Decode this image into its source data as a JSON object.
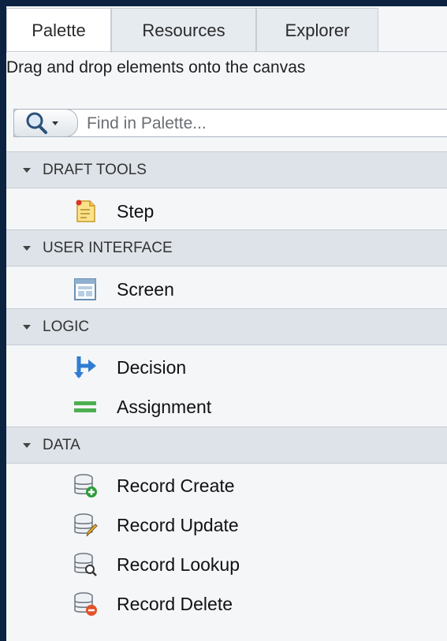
{
  "tabs": [
    {
      "label": "Palette",
      "active": true
    },
    {
      "label": "Resources",
      "active": false
    },
    {
      "label": "Explorer",
      "active": false
    }
  ],
  "hint": "Drag and drop elements onto the canvas",
  "search": {
    "placeholder": "Find in Palette..."
  },
  "sections": [
    {
      "title": "DRAFT TOOLS",
      "items": [
        {
          "label": "Step",
          "icon": "step-note-icon"
        }
      ]
    },
    {
      "title": "USER INTERFACE",
      "items": [
        {
          "label": "Screen",
          "icon": "screen-icon"
        }
      ]
    },
    {
      "title": "LOGIC",
      "items": [
        {
          "label": "Decision",
          "icon": "decision-arrow-icon"
        },
        {
          "label": "Assignment",
          "icon": "assignment-equals-icon"
        }
      ]
    },
    {
      "title": "DATA",
      "items": [
        {
          "label": "Record Create",
          "icon": "record-create-icon"
        },
        {
          "label": "Record Update",
          "icon": "record-update-icon"
        },
        {
          "label": "Record Lookup",
          "icon": "record-lookup-icon"
        },
        {
          "label": "Record Delete",
          "icon": "record-delete-icon"
        }
      ]
    }
  ],
  "colors": {
    "page_bg": "#0b2340",
    "panel_bg": "#f4f6f8",
    "section_bg": "#dde3e8",
    "record_create": "#2e9d3a",
    "record_delete": "#e2522a",
    "decision_blue": "#2f7dd3",
    "assignment_green": "#4caf50"
  }
}
